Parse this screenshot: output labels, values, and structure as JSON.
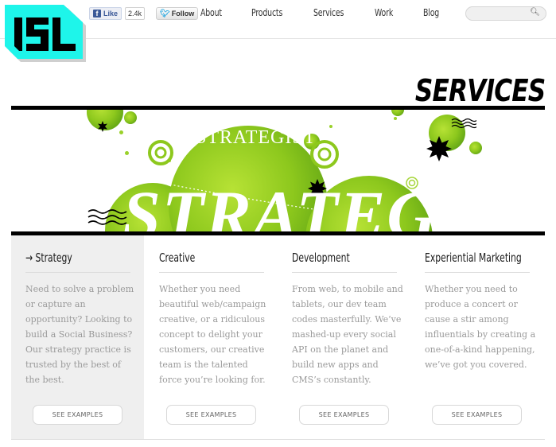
{
  "brand": {
    "logo_text": "ISL",
    "accent": "#1ef5ea"
  },
  "social": {
    "facebook_like_label": "Like",
    "facebook_like_count": "2.4k",
    "twitter_follow_label": "Follow"
  },
  "nav": {
    "items": [
      {
        "label": "About"
      },
      {
        "label": "Products"
      },
      {
        "label": "Services"
      },
      {
        "label": "Work"
      },
      {
        "label": "Blog"
      }
    ]
  },
  "search": {
    "placeholder": "",
    "value": ""
  },
  "page": {
    "title": "SERVICES"
  },
  "banner": {
    "headline": "STRATEGY",
    "subline": "STRATEGIST"
  },
  "services": [
    {
      "title": "Strategy",
      "active": true,
      "arrow": "→",
      "description": "Need to solve a problem or capture an opportunity? Looking to build a Social Business? Our strategy practice is trusted by the best of the best.",
      "button_label": "SEE EXAMPLES"
    },
    {
      "title": "Creative",
      "active": false,
      "description": "Whether you need beautiful web/campaign creative, or a ridiculous concept to delight your customers, our creative team is the talented force you’re looking for.",
      "button_label": "SEE EXAMPLES"
    },
    {
      "title": "Development",
      "active": false,
      "description": "From web, to mobile and tablets, our dev team codes masterfully. We’ve mashed-up every social API on the planet and build new apps and CMS’s constantly.",
      "button_label": "SEE EXAMPLES"
    },
    {
      "title": "Experiential Marketing",
      "active": false,
      "description": "Whether you need to produce a concert or cause a stir among influentials by creating a one-of-a-kind happening, we’ve got you covered.",
      "button_label": "SEE EXAMPLES"
    }
  ]
}
